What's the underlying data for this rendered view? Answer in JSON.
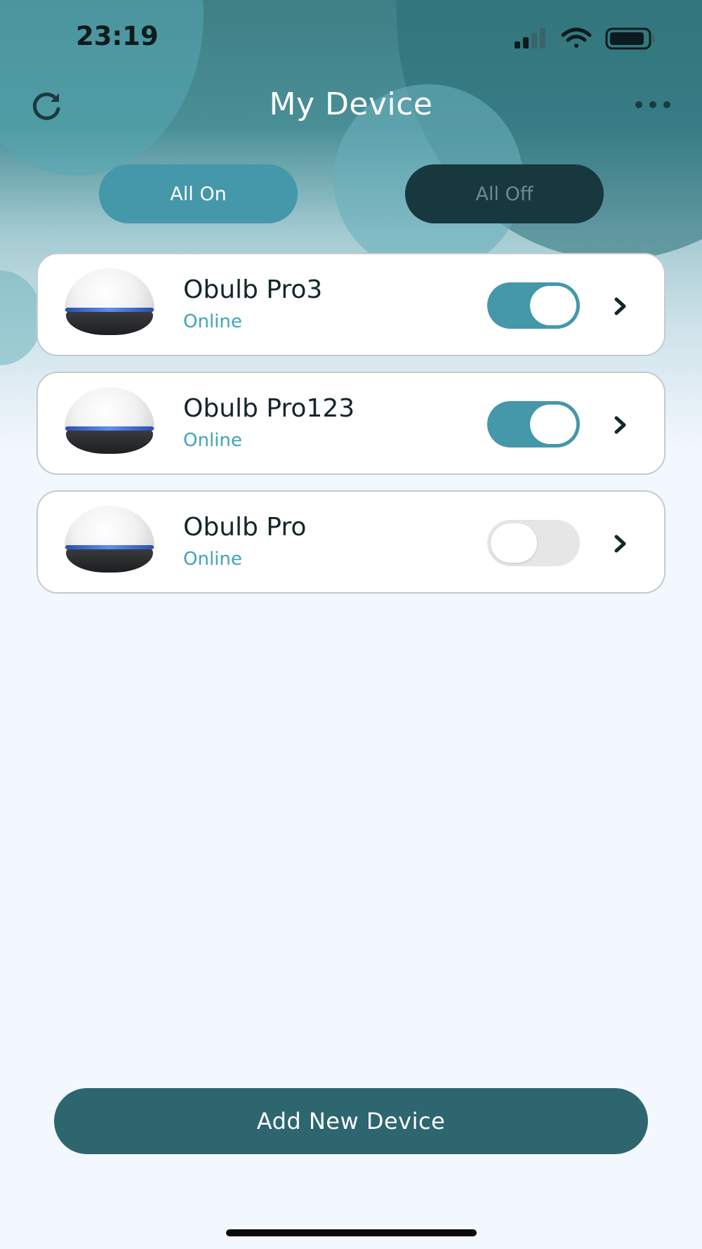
{
  "status_bar": {
    "time": "23:19"
  },
  "header": {
    "title": "My Device"
  },
  "controls": {
    "all_on": "All On",
    "all_off": "All Off"
  },
  "devices": [
    {
      "name": "Obulb Pro3",
      "status": "Online",
      "power_on": true
    },
    {
      "name": "Obulb Pro123",
      "status": "Online",
      "power_on": true
    },
    {
      "name": "Obulb Pro",
      "status": "Online",
      "power_on": false
    }
  ],
  "footer": {
    "add_device": "Add New Device"
  },
  "icons": {
    "refresh": "refresh-icon",
    "more": "more-icon",
    "chevron": "chevron-right-icon",
    "signal": "signal-icon",
    "wifi": "wifi-icon",
    "battery": "battery-icon"
  },
  "colors": {
    "accent": "#4597aa",
    "dark": "#17383e",
    "online": "#3fa4b8",
    "add_button": "#2e6670"
  }
}
